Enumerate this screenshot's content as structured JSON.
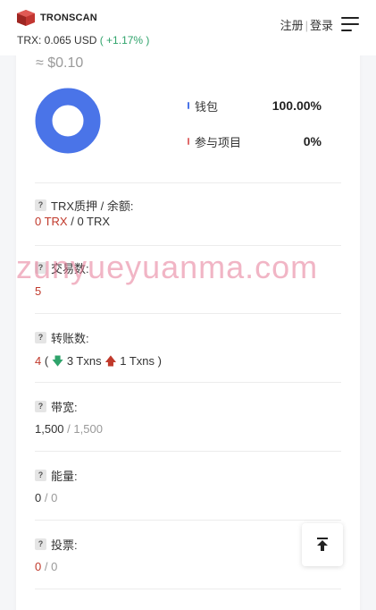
{
  "header": {
    "brand": "TRONSCAN",
    "price_prefix": "TRX: 0.065 USD",
    "price_change": "( +1.17% )",
    "register": "注册",
    "separator": "|",
    "login": "登录"
  },
  "overview": {
    "usd_value": "≈ $0.10",
    "legend": [
      {
        "label": "钱包",
        "value": "100.00%",
        "color": "#4a74e8"
      },
      {
        "label": "参与项目",
        "value": "0%",
        "color": "#e06b6b"
      }
    ]
  },
  "chart_data": {
    "type": "pie",
    "categories": [
      "钱包",
      "参与项目"
    ],
    "values": [
      100,
      0
    ],
    "colors": [
      "#4a74e8",
      "#e06b6b"
    ]
  },
  "fields": {
    "stake": {
      "label": "TRX质押 / 余额:",
      "v1": "0 TRX",
      "sep": " / ",
      "v2": "0 TRX"
    },
    "transactions": {
      "label": "交易数:",
      "value": "5"
    },
    "transfers": {
      "label": "转账数:",
      "count": "4",
      "open": "(",
      "in": "3 Txns",
      "out": "1 Txns",
      "close": ")"
    },
    "bandwidth": {
      "label": "带宽:",
      "used": "1,500",
      "sep": " / ",
      "total": "1,500"
    },
    "energy": {
      "label": "能量:",
      "used": "0",
      "sep": " / ",
      "total": "0"
    },
    "votes": {
      "label": "投票:",
      "used": "0",
      "sep": " / ",
      "total": "0"
    }
  },
  "watermark": "zunyueyuanma.com",
  "icons": {
    "logo": "tronscan-logo-icon",
    "menu": "hamburger-menu-icon",
    "help": "question-icon",
    "in": "arrow-down-icon",
    "out": "arrow-up-icon",
    "top": "back-to-top-icon"
  }
}
